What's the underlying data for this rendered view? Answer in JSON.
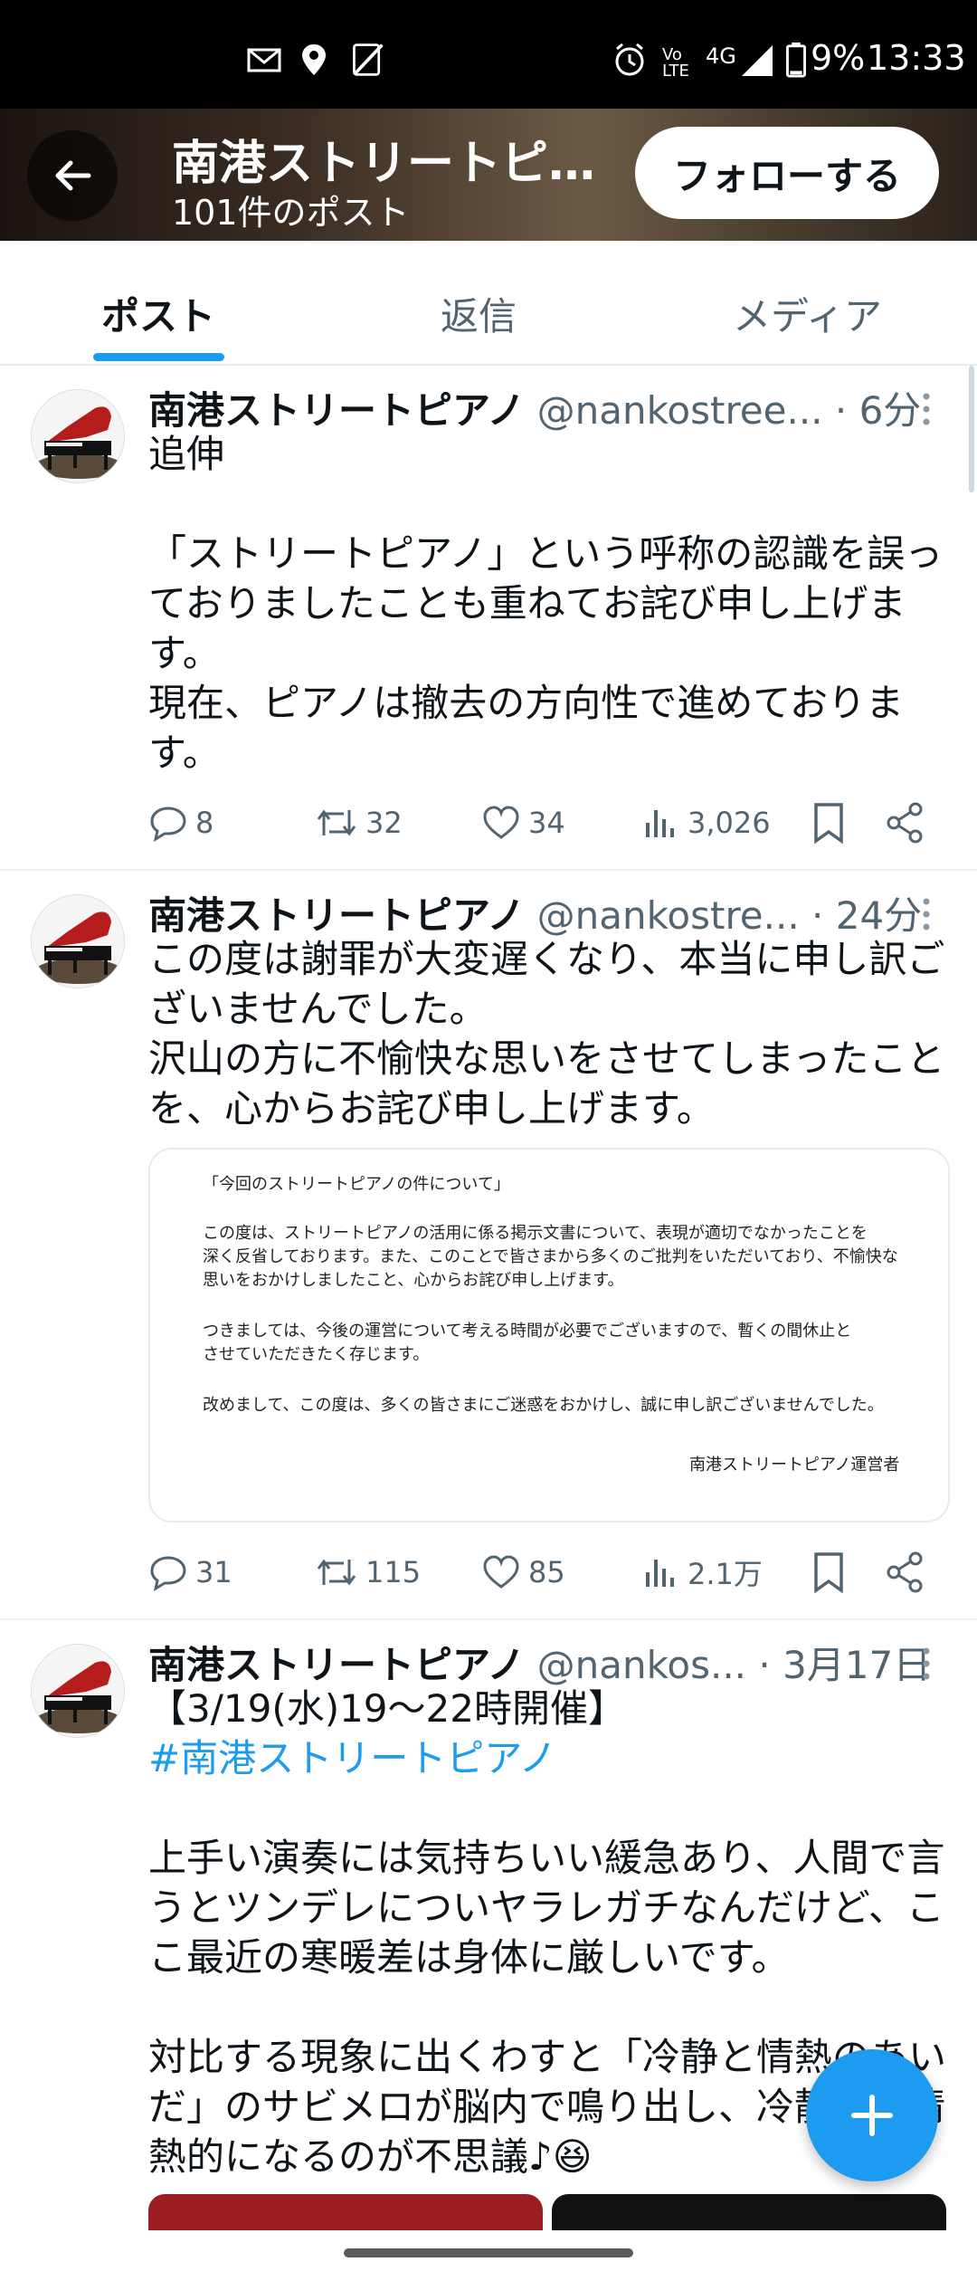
{
  "status_bar": {
    "battery": "9%",
    "time": "13:33",
    "network": "4G",
    "volte": "Vo LTE"
  },
  "header": {
    "title": "南港ストリートピ…",
    "post_count": "101件のポスト",
    "follow_label": "フォローする",
    "gradient_colors": [
      "#1b1410",
      "#6b5a45"
    ]
  },
  "tabs": [
    {
      "label": "ポスト",
      "active": true
    },
    {
      "label": "返信",
      "active": false
    },
    {
      "label": "メディア",
      "active": false
    }
  ],
  "posts": [
    {
      "name": "南港ストリートピアノ",
      "handle": "@nankostree...",
      "time": " · 6分",
      "text": "追伸\n\n「ストリートピアノ」という呼称の認識を誤っておりましたことも重ねてお詫び申し上げます。\n現在、ピアノは撤去の方向性で進めております。",
      "replies": "8",
      "reposts": "32",
      "likes": "34",
      "views": "3,026"
    },
    {
      "name": "南港ストリートピアノ",
      "handle": "@nankostre...",
      "time": " · 24分",
      "text": "この度は謝罪が大変遅くなり、本当に申し訳ございませんでした。\n沢山の方に不愉快な思いをさせてしまったことを、心からお詫び申し上げます。",
      "image_lines": [
        "「今回のストリートピアノの件について」",
        "この度は、ストリートピアノの活用に係る掲示文書について、表現が適切でなかったことを",
        "深く反省しております。また、このことで皆さまから多くのご批判をいただいており、不愉快な",
        "思いをおかけしましたこと、心からお詫び申し上げます。",
        "つきましては、今後の運営について考える時間が必要でございますので、暫くの間休止と",
        "させていただきたく存じます。",
        "改めまして、この度は、多くの皆さまにご迷惑をおかけし、誠に申し訳ございませんでした。",
        "南港ストリートピアノ運営者"
      ],
      "replies": "31",
      "reposts": "115",
      "likes": "85",
      "views": "2.1万"
    },
    {
      "name": "南港ストリートピアノ",
      "handle": "@nankos...",
      "time": " · 3月17日",
      "text_line1": "【3/19(水)19〜22時開催】",
      "hashtag": "#南港ストリートピアノ",
      "text_rest": "上手い演奏には気持ちいい緩急あり、人間で言うとツンデレについヤラレガチなんだけど、ここ最近の寒暖差は身体に厳しいです。\n\n対比する現象に出くわすと「冷静と情熱のあいだ」のサビメロが脳内で鳴り出し、冷静にく情熱的になるのが不思議♪😆"
    }
  ],
  "colors": {
    "accent": "#1d9bf0",
    "muted": "#536471",
    "text": "#0f1419"
  }
}
